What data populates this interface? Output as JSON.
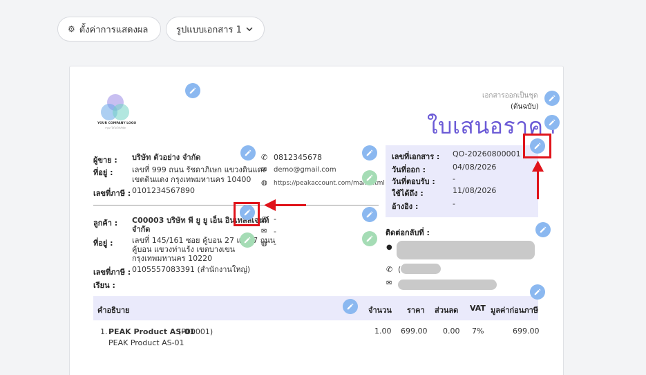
{
  "toolbar": {
    "display_settings": "ตั้งค่าการแสดงผล",
    "doc_format": "รูปแบบเอกสาร 1"
  },
  "logo": {
    "text": "YOUR COMPANY LOGO",
    "subtext": "กรุณาใส่โลโก้บริษัท"
  },
  "header": {
    "doc_set_label": "เอกสารออกเป็นชุด",
    "original_label": "(ต้นฉบับ)",
    "title": "ใบเสนอราคา"
  },
  "seller": {
    "name_label": "ผู้ขาย :",
    "name": "บริษัท ตัวอย่าง จำกัด",
    "address_label": "ที่อยู่ :",
    "address_line1": "เลขที่ 999 ถนน รัชดาภิเษก แขวงดินแดง",
    "address_line2": "เขตดินแดง กรุงเทพมหานคร 10400",
    "tax_label": "เลขที่ภาษี :",
    "tax": "0101234567890",
    "phone": "0812345678",
    "email": "demo@gmail.com",
    "website": "https://peakaccount.com/main.html"
  },
  "customer": {
    "name_label": "ลูกค้า :",
    "name_line1": "C00003 บริษัท พี ยู ยู เอ็น อินเทลลิเจนท์",
    "name_line2": "จำกัด",
    "address_label": "ที่อยู่ :",
    "address_line1": "เลขที่ 145/161 ซอย คู้บอน 27 แยก 7 ถนน",
    "address_line2": "คู้บอน แขวงท่าแร้ง เขตบางเขน",
    "address_line3": "กรุงเทพมหานคร 10220",
    "tax_label": "เลขที่ภาษี :",
    "tax": "0105557083391 (สำนักงานใหญ่)",
    "attn_label": "เรียน :",
    "phone": "-",
    "email": "-",
    "website": "-"
  },
  "docinfo": {
    "number_label": "เลขที่เอกสาร :",
    "number": "QO-20260800001",
    "issue_label": "วันที่ออก :",
    "issue": "04/08/2026",
    "reply_label": "วันที่ตอบรับ :",
    "reply": "-",
    "valid_label": "ใช้ได้ถึง :",
    "valid": "11/08/2026",
    "ref_label": "อ้างอิง :",
    "ref": "-"
  },
  "contact": {
    "label": "ติดต่อกลับที่ :",
    "phone_prefix": "("
  },
  "table": {
    "headers": {
      "desc": "คำอธิบาย",
      "qty": "จำนวน",
      "price": "ราคา",
      "discount": "ส่วนลด",
      "vat": "VAT",
      "amount": "มูลค่าก่อนภาษี"
    },
    "rows": [
      {
        "no": "1.",
        "name": "PEAK Product AS-01",
        "code": "(P00001)",
        "desc2": "PEAK Product AS-01",
        "qty": "1.00",
        "price": "699.00",
        "discount": "0.00",
        "vat": "7%",
        "amount": "699.00"
      }
    ]
  },
  "colors": {
    "accent": "#6b5ad6",
    "highlight": "#e0141b",
    "pen": "#8bb8f0",
    "pen_alt": "#a5dcb5",
    "box_bg": "#eaeafb"
  }
}
